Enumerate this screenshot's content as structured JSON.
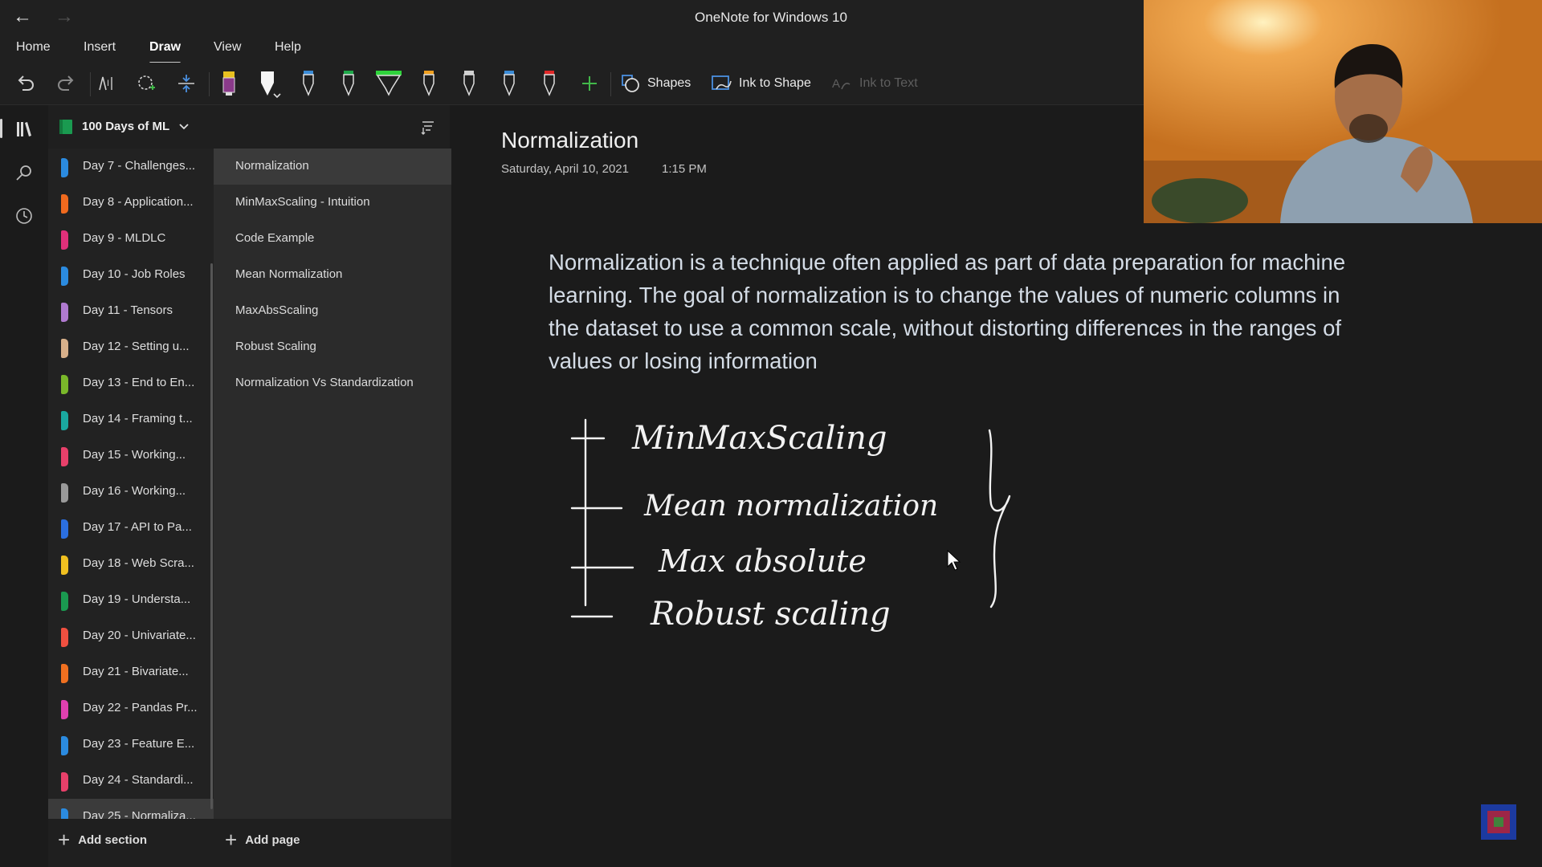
{
  "app": {
    "title": "OneNote for Windows 10"
  },
  "ribbon": {
    "tabs": [
      {
        "label": "Home"
      },
      {
        "label": "Insert"
      },
      {
        "label": "Draw"
      },
      {
        "label": "View"
      },
      {
        "label": "Help"
      }
    ],
    "active_tab": "Draw",
    "shapes_label": "Shapes",
    "ink_to_shape_label": "Ink to Shape",
    "ink_to_text_label": "Ink to Text",
    "pen_colors": [
      "#8a3a8a",
      "#ffffff",
      "#3a8bd6",
      "#1fa84a",
      "#2fd33b",
      "#f0a020",
      "#d0d0d0",
      "#3a8bd6",
      "#e02828"
    ]
  },
  "notebook": {
    "name": "100 Days of ML"
  },
  "sections": [
    {
      "label": "Day 7 - Challenges...",
      "color": "#2b8be0"
    },
    {
      "label": "Day 8 - Application...",
      "color": "#f06a1e"
    },
    {
      "label": "Day 9 - MLDLC",
      "color": "#e0307a"
    },
    {
      "label": "Day 10 - Job Roles",
      "color": "#2b8be0"
    },
    {
      "label": "Day 11 - Tensors",
      "color": "#b07ad0"
    },
    {
      "label": "Day 12 - Setting u...",
      "color": "#d8b08a"
    },
    {
      "label": "Day 13 - End to En...",
      "color": "#7ab82a"
    },
    {
      "label": "Day 14 - Framing t...",
      "color": "#1aa8a0"
    },
    {
      "label": "Day 15 - Working...",
      "color": "#e8406a"
    },
    {
      "label": "Day 16 - Working...",
      "color": "#9a9a9a"
    },
    {
      "label": "Day 17 - API to Pa...",
      "color": "#2b6fe0"
    },
    {
      "label": "Day 18 - Web Scra...",
      "color": "#f0c020"
    },
    {
      "label": "Day 19 - Understa...",
      "color": "#1a9a50"
    },
    {
      "label": "Day 20 - Univariate...",
      "color": "#f05040"
    },
    {
      "label": "Day 21 - Bivariate...",
      "color": "#f07020"
    },
    {
      "label": "Day 22 - Pandas Pr...",
      "color": "#e040b0"
    },
    {
      "label": "Day 23 - Feature E...",
      "color": "#2b8be0"
    },
    {
      "label": "Day 24 - Standardi...",
      "color": "#e8406a"
    },
    {
      "label": "Day 25 - Normaliza...",
      "color": "#2b8be0"
    }
  ],
  "pages": [
    {
      "label": "Normalization"
    },
    {
      "label": "MinMaxScaling - Intuition"
    },
    {
      "label": "Code Example"
    },
    {
      "label": "Mean Normalization"
    },
    {
      "label": "MaxAbsScaling"
    },
    {
      "label": "Robust Scaling"
    },
    {
      "label": "Normalization Vs Standardization"
    }
  ],
  "bottom": {
    "add_section": "Add section",
    "add_page": "Add page"
  },
  "page": {
    "title": "Normalization",
    "date": "Saturday, April 10, 2021",
    "time": "1:15 PM",
    "body": "Normalization is a technique often applied as part of data preparation for machine learning. The goal of normalization is to change the values of numeric columns in the dataset to use a common scale, without distorting differences in the ranges of values or losing information",
    "ink_notes": [
      "MinMaxScaling",
      "Mean normalization",
      "Max absolute",
      "Robust scaling"
    ]
  }
}
